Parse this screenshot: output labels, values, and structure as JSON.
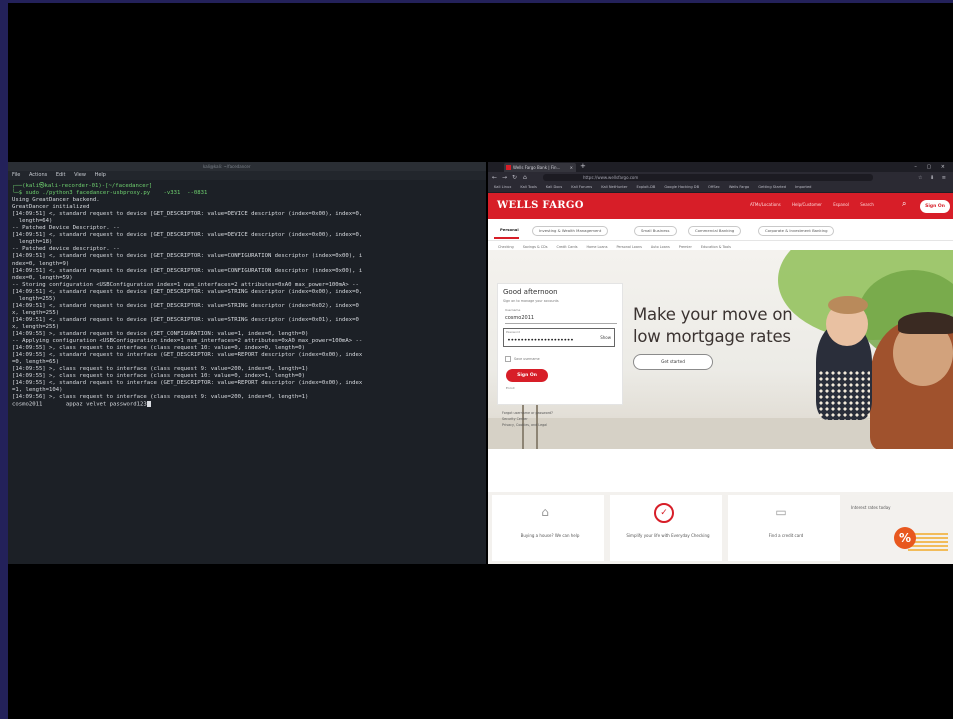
{
  "terminal": {
    "title": "kali@kali: ~/facedancer",
    "menu": [
      "File",
      "Actions",
      "Edit",
      "View",
      "Help"
    ],
    "lines": [
      {
        "text": "┌──(kali㉿kali-recorder-01)-[~/facedancer]",
        "cls": "prompt"
      },
      {
        "text": "└─$ sudo ./python3 facedancer-usbproxy.py    -v331  --0831",
        "cls": "prompt"
      },
      {
        "text": "Using GreatDancer backend.",
        "cls": ""
      },
      {
        "text": "GreatDancer initialized",
        "cls": ""
      },
      {
        "text": "[14:09:51] <, standard request to device [GET_DESCRIPTOR: value=DEVICE descriptor (index=0x00), index=0,",
        "cls": ""
      },
      {
        "text": "  length=64)",
        "cls": ""
      },
      {
        "text": "-- Patched Device Descriptor. --",
        "cls": ""
      },
      {
        "text": "[14:09:51] <, standard request to device [GET_DESCRIPTOR: value=DEVICE descriptor (index=0x00), index=0,",
        "cls": ""
      },
      {
        "text": "  length=18)",
        "cls": ""
      },
      {
        "text": "-- Patched device descriptor. --",
        "cls": ""
      },
      {
        "text": "[14:09:51] <, standard request to device [GET_DESCRIPTOR: value=CONFIGURATION descriptor (index=0x00), i",
        "cls": ""
      },
      {
        "text": "ndex=0, length=9)",
        "cls": ""
      },
      {
        "text": "[14:09:51] <, standard request to device [GET_DESCRIPTOR: value=CONFIGURATION descriptor (index=0x00), i",
        "cls": ""
      },
      {
        "text": "ndex=0, length=59)",
        "cls": ""
      },
      {
        "text": "-- Storing configuration <USBConfiguration index=1 num_interfaces=2 attributes=0xA0 max_power=100mA> --",
        "cls": ""
      },
      {
        "text": "[14:09:51] <, standard request to device [GET_DESCRIPTOR: value=STRING descriptor (index=0x00), index=0,",
        "cls": ""
      },
      {
        "text": "  length=255)",
        "cls": ""
      },
      {
        "text": "[14:09:51] <, standard request to device [GET_DESCRIPTOR: value=STRING descriptor (index=0x02), index=0",
        "cls": ""
      },
      {
        "text": "x, length=255)",
        "cls": ""
      },
      {
        "text": "[14:09:51] <, standard request to device [GET_DESCRIPTOR: value=STRING descriptor (index=0x01), index=0",
        "cls": ""
      },
      {
        "text": "x, length=255)",
        "cls": ""
      },
      {
        "text": "[14:09:55] >, standard request to device (SET_CONFIGURATION: value=1, index=0, length=0)",
        "cls": ""
      },
      {
        "text": "-- Applying configuration <USBConfiguration index=1 num_interfaces=2 attributes=0xA0 max_power=100mA> --",
        "cls": ""
      },
      {
        "text": "[14:09:55] >, class request to interface (class request 10: value=0, index=0, length=0)",
        "cls": ""
      },
      {
        "text": "[14:09:55] <, standard request to interface (GET_DESCRIPTOR: value=REPORT descriptor (index=0x00), index",
        "cls": ""
      },
      {
        "text": "=0, length=65)",
        "cls": ""
      },
      {
        "text": "[14:09:55] >, class request to interface (class request 9: value=200, index=0, length=1)",
        "cls": ""
      },
      {
        "text": "[14:09:55] >, class request to interface (class request 10: value=0, index=1, length=0)",
        "cls": ""
      },
      {
        "text": "[14:09:55] <, standard request to interface (GET_DESCRIPTOR: value=REPORT descriptor (index=0x00), index",
        "cls": ""
      },
      {
        "text": "=1, length=104)",
        "cls": ""
      },
      {
        "text": "[14:09:56] >, class request to interface (class request 9: value=200, index=0, length=1)",
        "cls": ""
      },
      {
        "text": "cosmo2011       appaz velvet password123",
        "cls": "",
        "cursor": true
      }
    ]
  },
  "browser": {
    "tab_title": "Wells Fargo Bank | Fin...",
    "url": "https://www.wellsfargo.com",
    "bookmarks": [
      "Kali Linux",
      "Kali Tools",
      "Kali Docs",
      "Kali Forums",
      "Kali NetHunter",
      "Exploit-DB",
      "Google Hacking DB",
      "OffSec",
      "Wells Fargo",
      "Getting Started",
      "Imported"
    ],
    "wf": {
      "logo": "WELLS FARGO",
      "nav": [
        "ATMs/Locations",
        "Help/Customer",
        "Espanol",
        "Search"
      ],
      "signon": "Sign On",
      "tabs": [
        "Personal",
        "Investing & Wealth Management",
        "Small Business",
        "Commercial Banking",
        "Corporate & Investment Banking"
      ],
      "subnav": [
        "Checking",
        "Savings & CDs",
        "Credit Cards",
        "Home Loans",
        "Personal Loans",
        "Auto Loans",
        "Premier",
        "Education & Tools"
      ],
      "headline": [
        "Make your move on",
        "low mortgage rates"
      ],
      "get_started": "Get started",
      "signon_card": {
        "greeting": "Good afternoon",
        "subtitle": "Sign on to manage your accounts",
        "username_label": "Username",
        "username": "cosmo2011",
        "password_label": "Password",
        "password_masked": "••••••••••••••••••••",
        "show": "Show",
        "save_username": "Save username",
        "sign_on": "Sign On",
        "enroll": "Enroll"
      },
      "links": [
        "Forgot username or password?",
        "Security Center",
        "Privacy, Cookies, and Legal"
      ],
      "cards": [
        {
          "icon": "⌂",
          "text": "Buying a house? We can help"
        },
        {
          "icon": "✓",
          "text": "Simplify your life with Everyday Checking"
        },
        {
          "icon": "▭",
          "text": "Find a credit card"
        }
      ],
      "rates_title": "Interest rates today",
      "rates_icon": "%"
    }
  }
}
